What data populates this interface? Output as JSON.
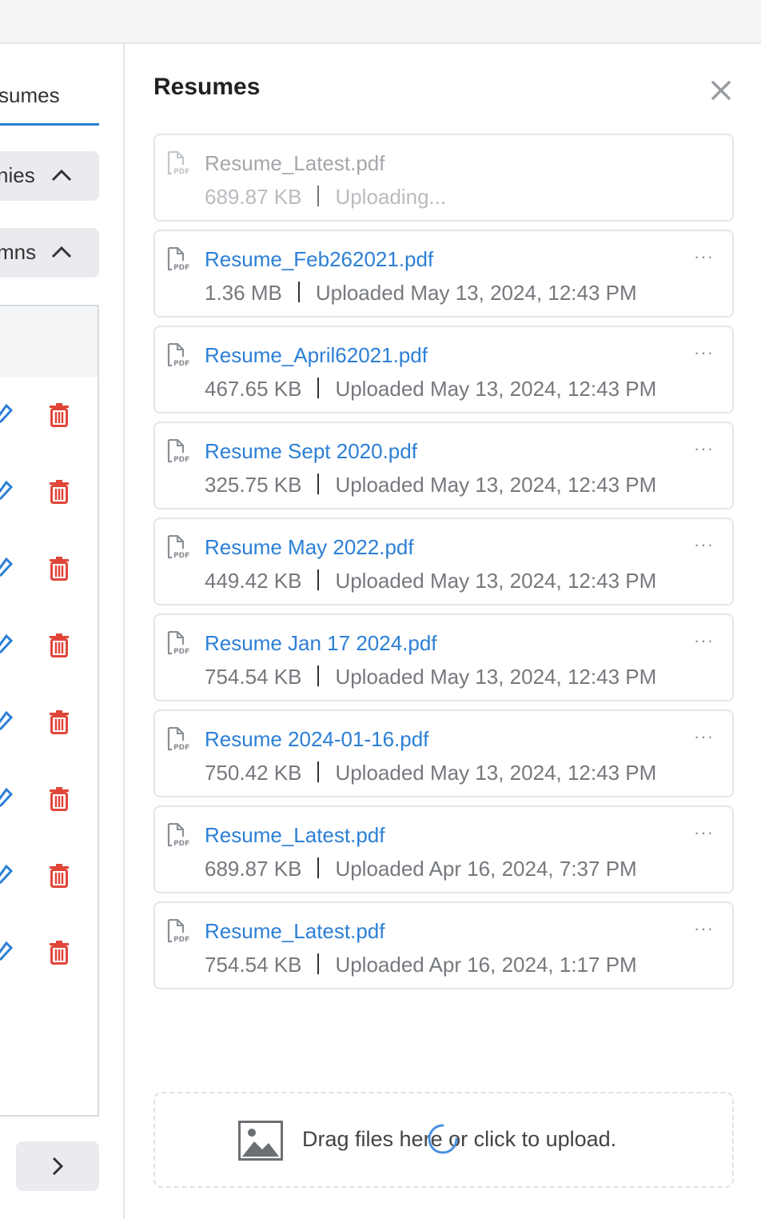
{
  "left": {
    "tab_label": "sumes",
    "sections": [
      {
        "label": "nies"
      },
      {
        "label": "mns"
      }
    ],
    "row_count": 8
  },
  "drawer": {
    "title": "Resumes",
    "close_icon": "close-icon",
    "files": [
      {
        "name": "Resume_Latest.pdf",
        "size": "689.87 KB",
        "status": "Uploading..."
      },
      {
        "name": "Resume_Feb262021.pdf",
        "size": "1.36 MB",
        "status": "Uploaded May 13, 2024, 12:43 PM"
      },
      {
        "name": "Resume_April62021.pdf",
        "size": "467.65 KB",
        "status": "Uploaded May 13, 2024, 12:43 PM"
      },
      {
        "name": "Resume Sept 2020.pdf",
        "size": "325.75 KB",
        "status": "Uploaded May 13, 2024, 12:43 PM"
      },
      {
        "name": "Resume May 2022.pdf",
        "size": "449.42 KB",
        "status": "Uploaded May 13, 2024, 12:43 PM"
      },
      {
        "name": "Resume Jan 17 2024.pdf",
        "size": "754.54 KB",
        "status": "Uploaded May 13, 2024, 12:43 PM"
      },
      {
        "name": "Resume 2024-01-16.pdf",
        "size": "750.42 KB",
        "status": "Uploaded May 13, 2024, 12:43 PM"
      },
      {
        "name": "Resume_Latest.pdf",
        "size": "689.87 KB",
        "status": "Uploaded Apr 16, 2024, 7:37 PM"
      },
      {
        "name": "Resume_Latest.pdf",
        "size": "754.54 KB",
        "status": "Uploaded Apr 16, 2024, 1:17 PM"
      }
    ],
    "more_label": "···",
    "dropzone_text": "Drag files here or click to upload."
  },
  "colors": {
    "accent": "#2b7fd6",
    "danger": "#e0453a",
    "muted": "#75797e"
  }
}
